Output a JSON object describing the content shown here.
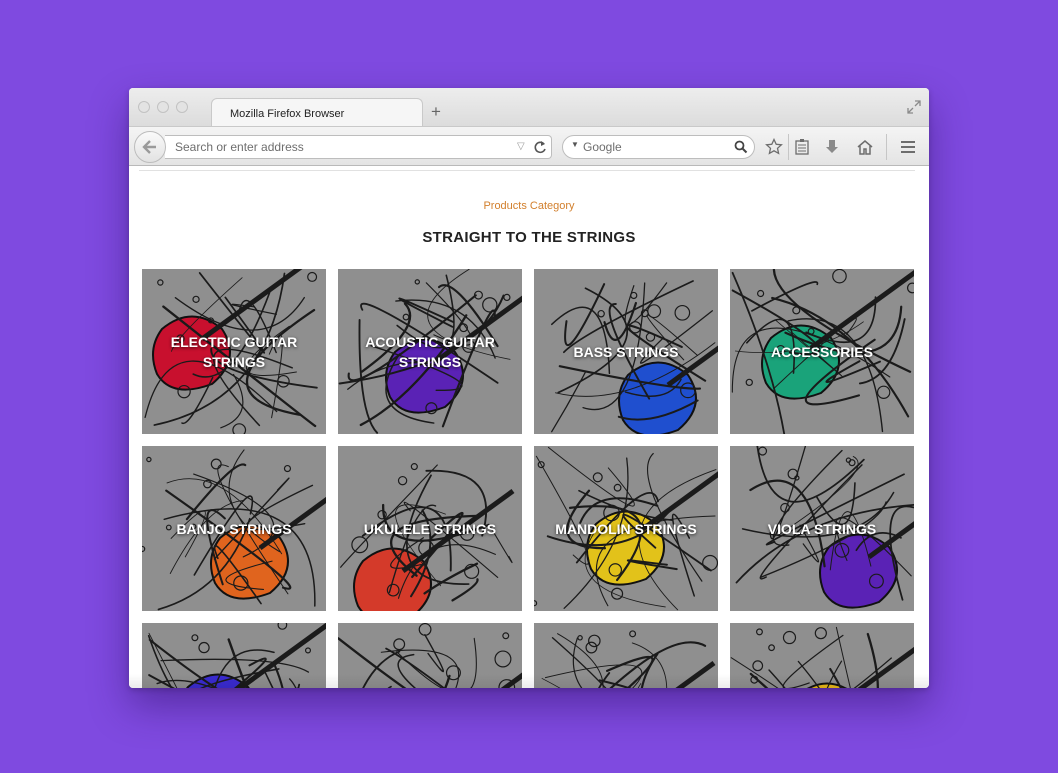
{
  "browser": {
    "tab_title": "Mozilla Firefox Browser",
    "address_placeholder": "Search or enter address",
    "search_placeholder": "Google"
  },
  "page": {
    "eyebrow": "Products Category",
    "heading": "STRAIGHT TO THE STRINGS"
  },
  "categories": [
    {
      "label": "ELECTRIC GUITAR STRINGS",
      "accent": "#c8102e"
    },
    {
      "label": "ACOUSTIC GUITAR STRINGS",
      "accent": "#5a22b5"
    },
    {
      "label": "BASS STRINGS",
      "accent": "#1f4fcf"
    },
    {
      "label": "ACCESSORIES",
      "accent": "#1aa37a"
    },
    {
      "label": "BANJO STRINGS",
      "accent": "#e0641e"
    },
    {
      "label": "UKULELE STRINGS",
      "accent": "#d43a2a"
    },
    {
      "label": "MANDOLIN STRINGS",
      "accent": "#e2c21a"
    },
    {
      "label": "VIOLA STRINGS",
      "accent": "#5a22b5"
    },
    {
      "label": "",
      "accent": "#3a2bd1"
    },
    {
      "label": "",
      "accent": "#c8322a"
    },
    {
      "label": "",
      "accent": "#e35a1c"
    },
    {
      "label": "",
      "accent": "#e8b81a"
    }
  ],
  "colors": {
    "background": "#7f4ae0",
    "eyebrow": "#d27f2c"
  }
}
